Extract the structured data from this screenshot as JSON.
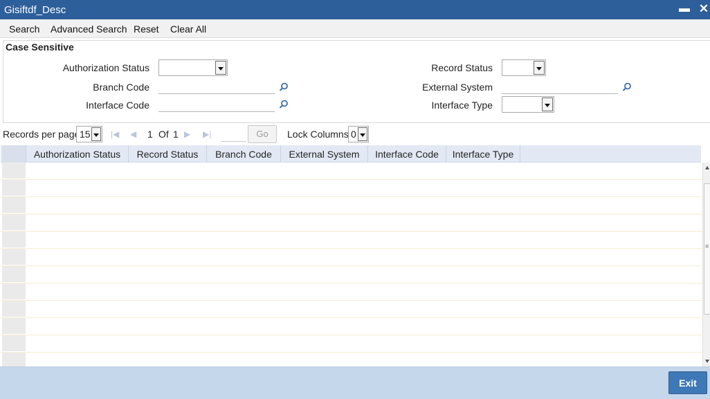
{
  "window": {
    "title": "Gisiftdf_Desc",
    "minimize_glyph": "▬",
    "close_glyph": "✕"
  },
  "toolbar": {
    "search": "Search",
    "advanced_search": "Advanced Search",
    "reset": "Reset",
    "clear_all": "Clear All"
  },
  "criteria": {
    "legend": "Case Sensitive",
    "authorization_status": {
      "label": "Authorization Status",
      "value": ""
    },
    "record_status": {
      "label": "Record Status",
      "value": ""
    },
    "branch_code": {
      "label": "Branch Code",
      "value": "",
      "icon": "search-icon"
    },
    "external_system": {
      "label": "External System",
      "value": "",
      "icon": "search-icon"
    },
    "interface_code": {
      "label": "Interface Code",
      "value": "",
      "icon": "search-icon"
    },
    "interface_type": {
      "label": "Interface Type",
      "value": ""
    }
  },
  "pager": {
    "records_per_page_label": "Records per page",
    "records_per_page": "15",
    "current_page": "1",
    "of_label": "Of",
    "total_pages": "1",
    "go_label": "Go",
    "lock_columns_label": "Lock Columns",
    "lock_columns": "0"
  },
  "grid": {
    "columns": [
      "Authorization Status",
      "Record Status",
      "Branch Code",
      "External System",
      "Interface Code",
      "Interface Type"
    ],
    "rows": []
  },
  "footer": {
    "exit_label": "Exit"
  },
  "colors": {
    "titlebar": "#2d5f9a",
    "header": "#e3e9f4",
    "footer": "#c5d7eb",
    "exit_button": "#3f78b6"
  }
}
